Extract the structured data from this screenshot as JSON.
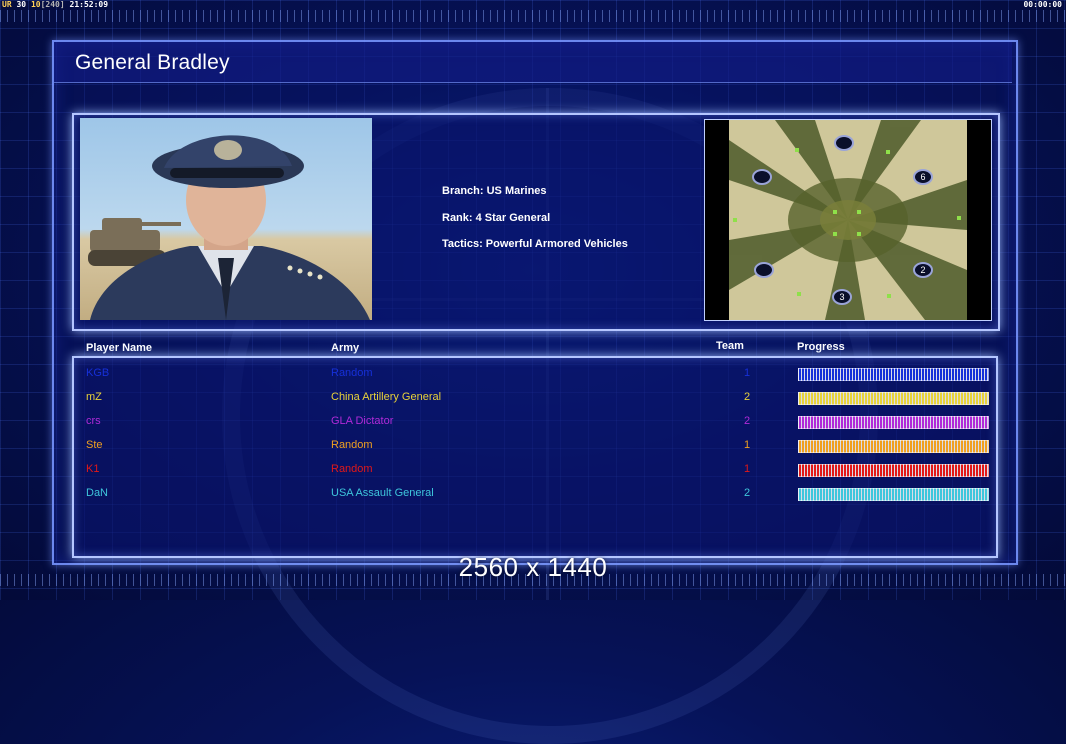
{
  "hud": {
    "left_ur": "UR",
    "left_a": "30",
    "left_b": "10",
    "left_c": "[240]",
    "left_time": "21:52:09",
    "right_time": "00:00:00"
  },
  "general": {
    "title": "General Bradley",
    "branch": "Branch: US Marines",
    "rank": "Rank: 4 Star General",
    "tactics": "Tactics: Powerful Armored Vehicles"
  },
  "map": {
    "spawn_labels": [
      "6",
      "2",
      "3"
    ]
  },
  "table": {
    "headers": {
      "player": "Player Name",
      "army": "Army",
      "team": "Team",
      "progress": "Progress"
    },
    "rows": [
      {
        "name": "KGB",
        "army": "Random",
        "team": "1",
        "color": "#1630d8",
        "progress": 1.0
      },
      {
        "name": "mZ",
        "army": "China Artillery General",
        "team": "2",
        "color": "#e8d23a",
        "progress": 1.0
      },
      {
        "name": "crs",
        "army": "GLA Dictator",
        "team": "2",
        "color": "#b02ad8",
        "progress": 1.0
      },
      {
        "name": "Ste",
        "army": "Random",
        "team": "1",
        "color": "#f0a020",
        "progress": 1.0
      },
      {
        "name": "K1",
        "army": "Random",
        "team": "1",
        "color": "#e21818",
        "progress": 1.0
      },
      {
        "name": "DaN",
        "army": "USA Assault General",
        "team": "2",
        "color": "#3ec6dc",
        "progress": 1.0
      }
    ]
  },
  "resolution_label": "2560 x 1440"
}
